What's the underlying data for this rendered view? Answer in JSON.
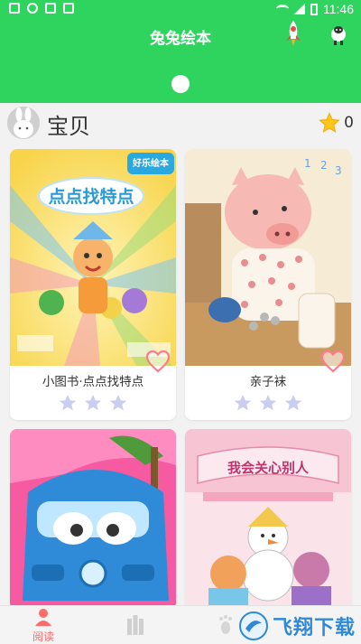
{
  "status_bar": {
    "time": "11:46"
  },
  "header": {
    "title": "兔兔绘本"
  },
  "profile": {
    "name": "宝贝",
    "star_count": "0"
  },
  "books": [
    {
      "cover_text": "点点找特点",
      "badge": "好乐绘本",
      "title": "小图书·点点找特点",
      "stars": 3,
      "theme": "#f7d44a"
    },
    {
      "cover_text": "",
      "title": "亲子袜",
      "stars": 3,
      "theme": "#f6e7c6"
    },
    {
      "cover_text": "",
      "title": "",
      "stars": 0,
      "theme": "#f65aa0"
    },
    {
      "cover_text": "我会关心别人",
      "title": "",
      "stars": 0,
      "theme": "#f9c6d6"
    }
  ],
  "bottom_nav": {
    "items": [
      {
        "label": "阅读",
        "active": true
      },
      {
        "label": "",
        "active": false
      },
      {
        "label": "",
        "active": false
      },
      {
        "label": "",
        "active": false
      }
    ]
  },
  "watermark": {
    "text": "飞翔下载"
  },
  "colors": {
    "header": "#2fd45f",
    "accent": "#ff6b6b",
    "star_empty": "#c9cdf2"
  }
}
